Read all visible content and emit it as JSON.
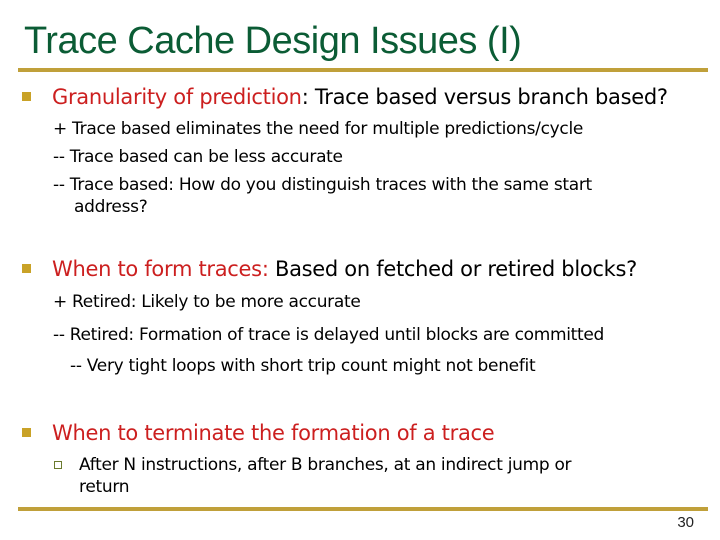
{
  "title": "Trace Cache Design Issues (I)",
  "colors": {
    "title": "#0b5c35",
    "rule": "#c0a03a",
    "highlight": "#cc1f1f",
    "bullet": "#c9a227"
  },
  "sections": [
    {
      "heading_highlight": "Granularity of prediction",
      "heading_rest": ": Trace based versus branch based?",
      "lines": [
        "+ Trace based eliminates the need for multiple predictions/cycle",
        "-- Trace based can be less accurate",
        "-- Trace based: How do you distinguish traces with the same start",
        "address?"
      ]
    },
    {
      "heading_highlight": "When to form traces:",
      "heading_rest": " Based on fetched or retired blocks?",
      "lines": [
        "+ Retired: Likely to be more accurate",
        "-- Retired: Formation of trace is delayed until blocks are committed",
        "-- Very tight loops with short trip count might not benefit"
      ]
    },
    {
      "heading_highlight": "When to terminate the formation of a trace",
      "heading_rest": "",
      "sub_bullet": {
        "icon": "hollow-square-bullet",
        "lines": [
          "After N instructions, after B branches, at an indirect jump or",
          "return"
        ]
      }
    }
  ],
  "page_number": "30"
}
